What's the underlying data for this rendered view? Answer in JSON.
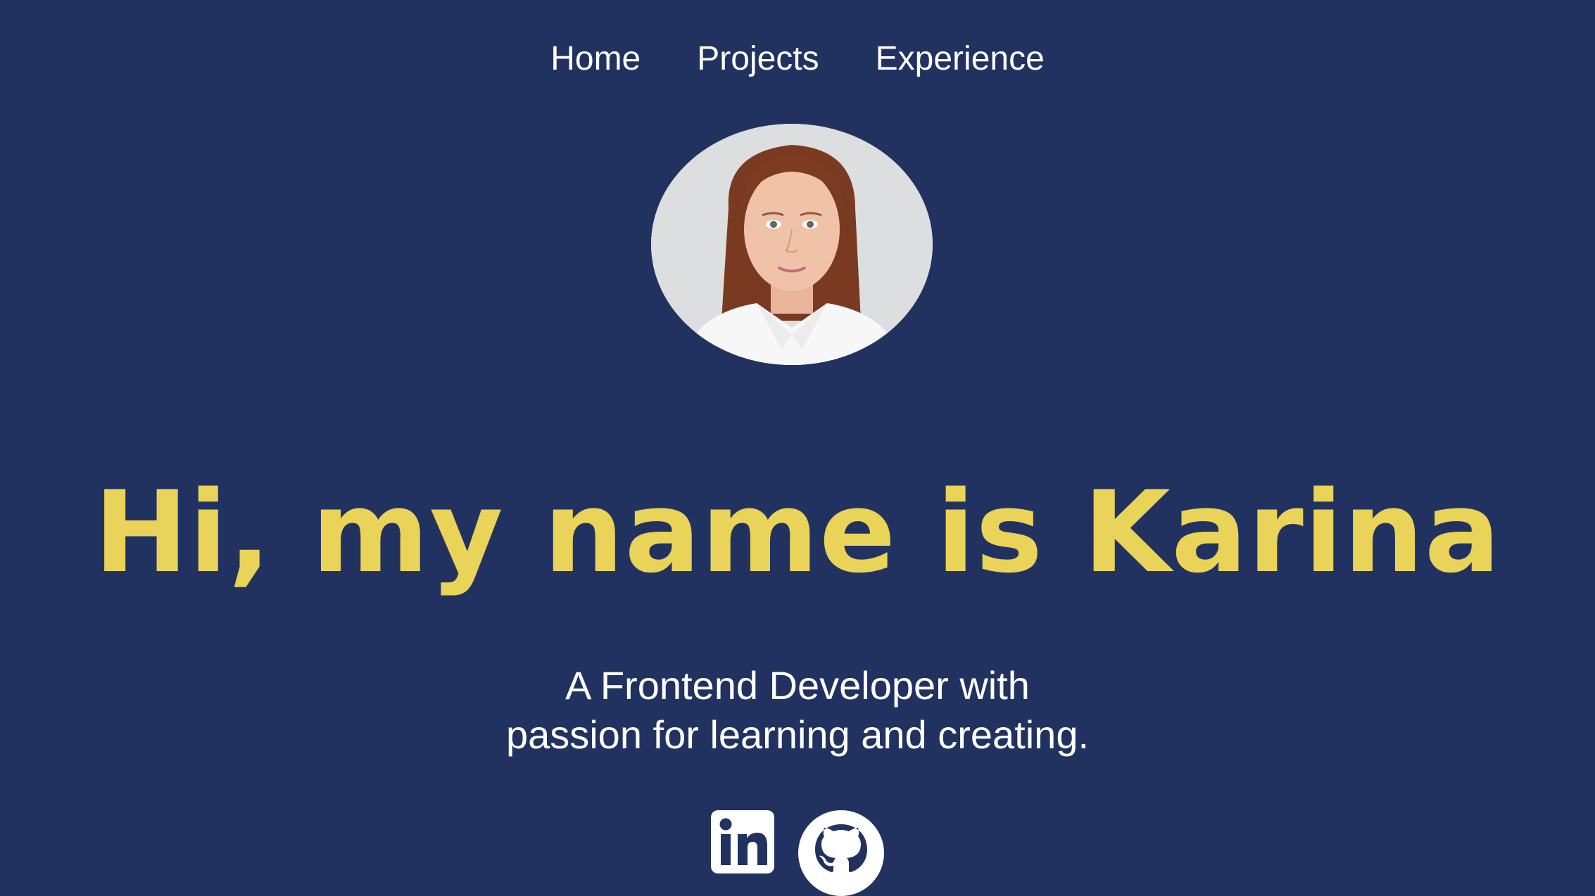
{
  "nav": {
    "items": [
      {
        "label": "Home"
      },
      {
        "label": "Projects"
      },
      {
        "label": "Experience"
      }
    ]
  },
  "hero": {
    "title": "Hi, my name is Karina",
    "subtitle_line1": "A Frontend Developer with",
    "subtitle_line2": "passion for learning and creating."
  },
  "socials": {
    "items": [
      {
        "icon": "linkedin-icon"
      },
      {
        "icon": "github-icon"
      }
    ]
  },
  "colors": {
    "background": "#223260",
    "accent": "#e9d358",
    "text": "#ffffff"
  }
}
